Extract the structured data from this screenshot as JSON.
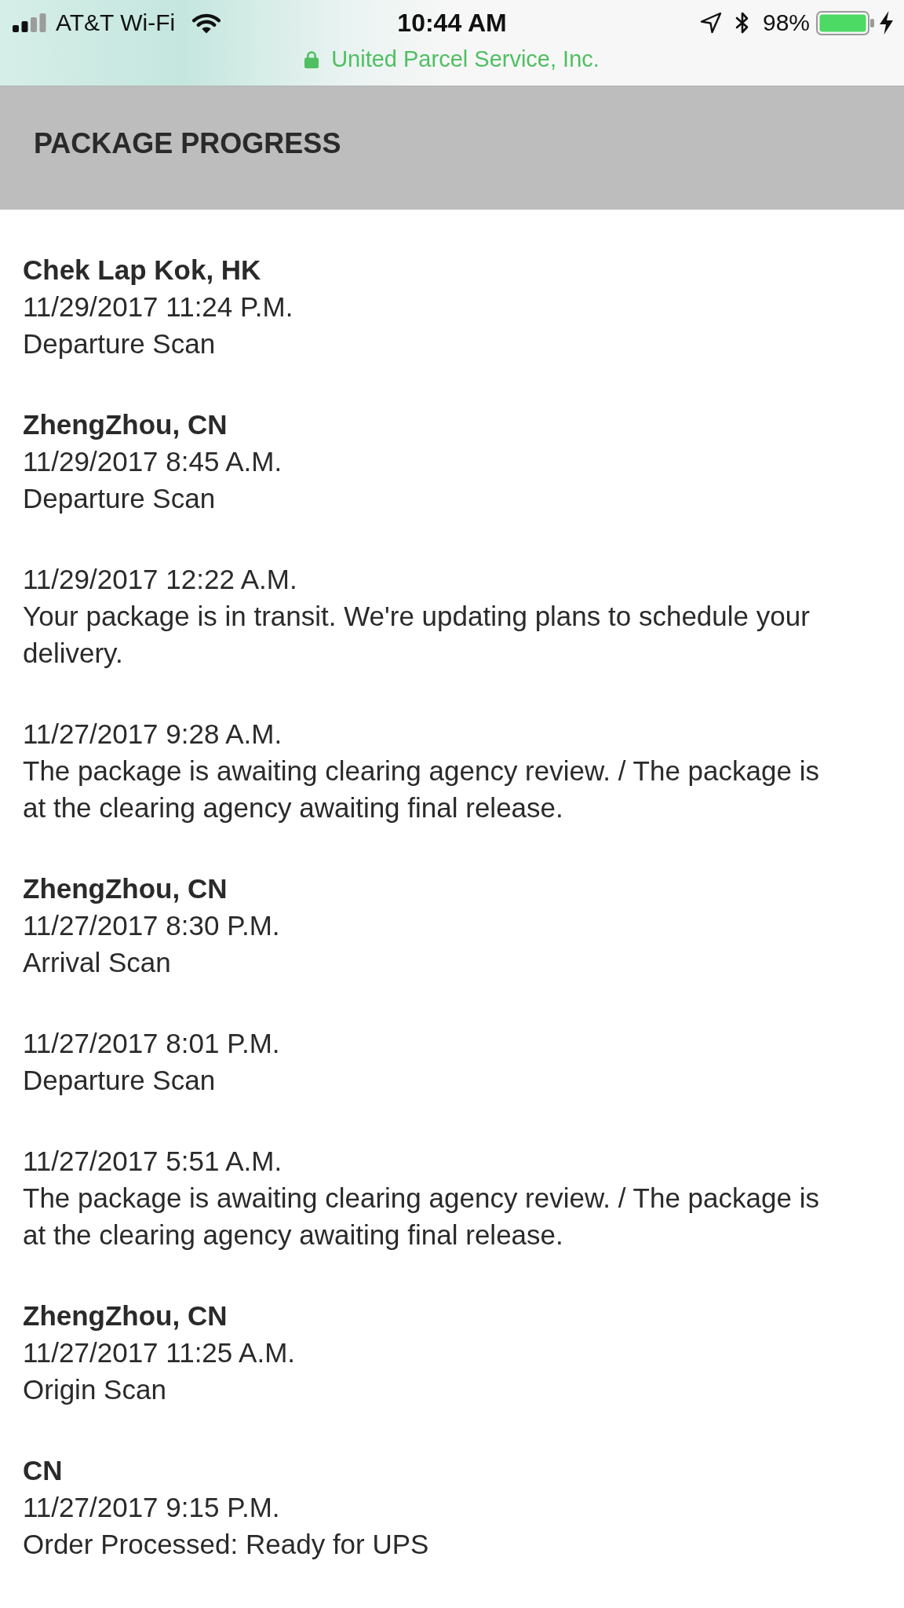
{
  "status_bar": {
    "carrier": "AT&T Wi-Fi",
    "time": "10:44 AM",
    "battery_percent": "98%",
    "site": "United Parcel Service, Inc."
  },
  "header": {
    "title": "PACKAGE PROGRESS"
  },
  "events": [
    {
      "location": "Chek Lap Kok, HK",
      "datetime": "11/29/2017 11:24 P.M.",
      "description": "Departure Scan"
    },
    {
      "location": "ZhengZhou, CN",
      "datetime": "11/29/2017 8:45 A.M.",
      "description": "Departure Scan"
    },
    {
      "datetime": "11/29/2017 12:22 A.M.",
      "description": "Your package is in transit. We're updating plans to schedule your delivery."
    },
    {
      "datetime": "11/27/2017 9:28 A.M.",
      "description": "The package is awaiting clearing agency review. / The package is at the clearing agency awaiting final release."
    },
    {
      "location": "ZhengZhou, CN",
      "datetime": "11/27/2017 8:30 P.M.",
      "description": "Arrival Scan"
    },
    {
      "datetime": "11/27/2017 8:01 P.M.",
      "description": "Departure Scan"
    },
    {
      "datetime": "11/27/2017 5:51 A.M.",
      "description": "The package is awaiting clearing agency review. / The package is at the clearing agency awaiting final release."
    },
    {
      "location": "ZhengZhou, CN",
      "datetime": "11/27/2017 11:25 A.M.",
      "description": "Origin Scan"
    },
    {
      "location": "CN",
      "datetime": "11/27/2017 9:15 P.M.",
      "description": "Order Processed: Ready for UPS"
    }
  ]
}
